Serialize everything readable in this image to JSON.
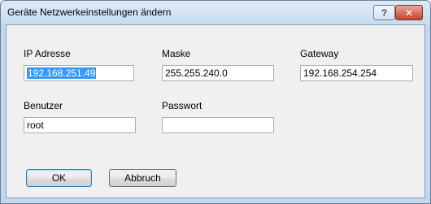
{
  "window": {
    "title": "Geräte Netzwerkeinstellungen ändern",
    "help_glyph": "?",
    "close_glyph": "✕"
  },
  "form": {
    "ip": {
      "label": "IP Adresse",
      "value": "192.168.251.49"
    },
    "mask": {
      "label": "Maske",
      "value": "255.255.240.0"
    },
    "gateway": {
      "label": "Gateway",
      "value": "192.168.254.254"
    },
    "user": {
      "label": "Benutzer",
      "value": "root"
    },
    "password": {
      "label": "Passwort",
      "value": ""
    }
  },
  "buttons": {
    "ok": "OK",
    "cancel": "Abbruch"
  }
}
